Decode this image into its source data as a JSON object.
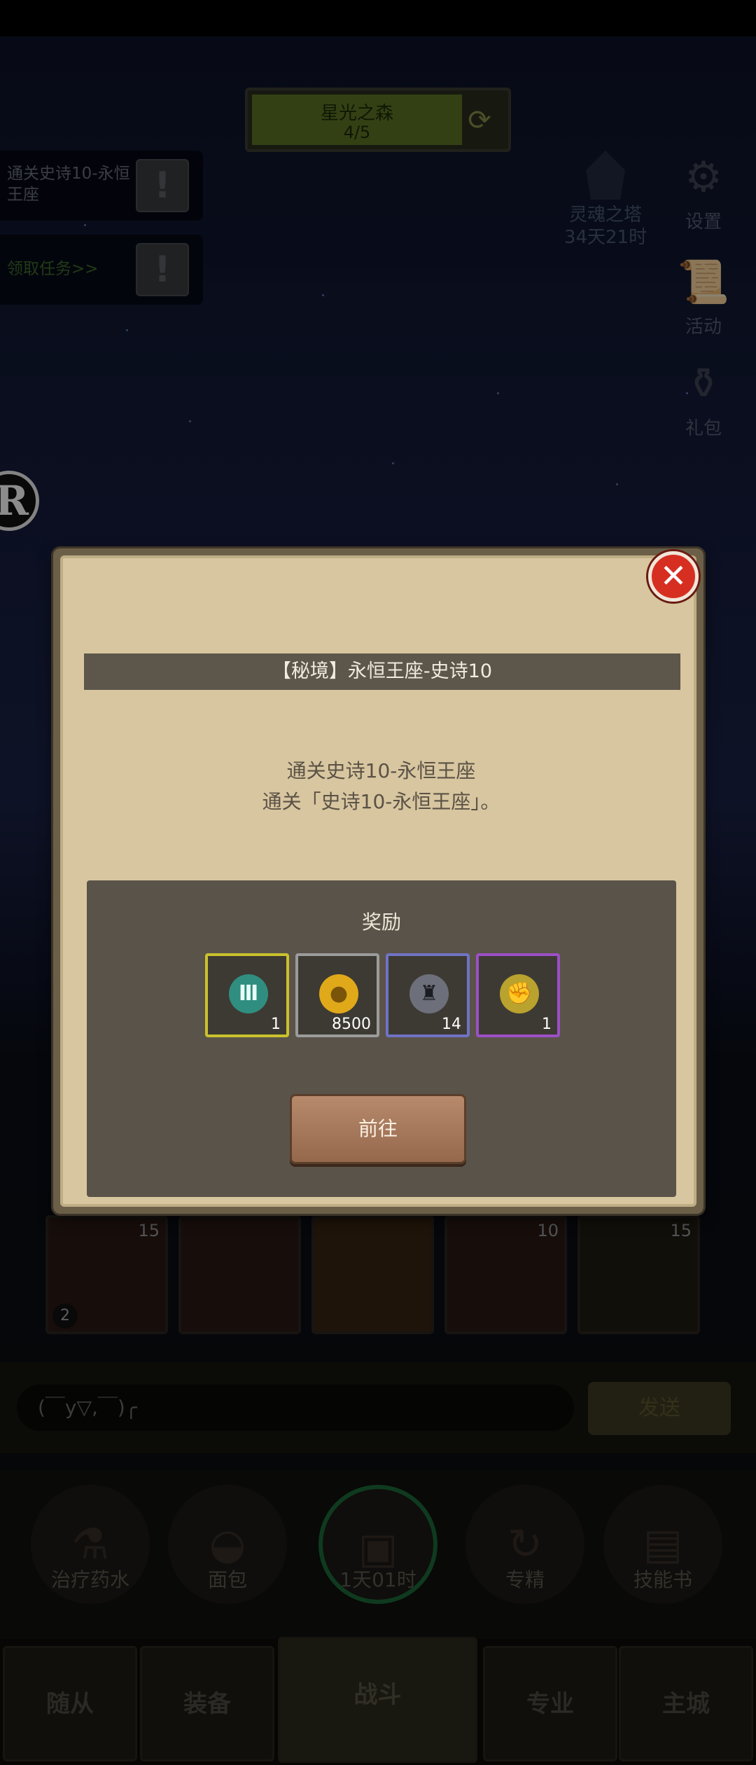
{
  "area": {
    "name": "星光之森",
    "progress": "4/5"
  },
  "quests": [
    {
      "text": "通关史诗10-永恒王座"
    },
    {
      "text": "领取任务>>"
    }
  ],
  "tower": {
    "name": "灵魂之塔",
    "timer": "34天21时"
  },
  "side_buttons": [
    {
      "label": "设置",
      "icon": "gear-icon"
    },
    {
      "label": "活动",
      "icon": "scroll-icon"
    },
    {
      "label": "礼包",
      "icon": "gift-pot-icon"
    }
  ],
  "heroes": [
    {
      "level": "15",
      "sub": "2"
    },
    {
      "level": "",
      "sub": ""
    },
    {
      "level": "",
      "sub": ""
    },
    {
      "level": "10",
      "sub": ""
    },
    {
      "level": "15",
      "sub": ""
    }
  ],
  "chat": {
    "placeholder": "(￣y▽,￣)╭",
    "send_label": "发送"
  },
  "shop": [
    {
      "label": "治疗药水",
      "icon": "potion-icon"
    },
    {
      "label": "面包",
      "icon": "bread-icon"
    },
    {
      "label": "1天01时",
      "icon": "chest-icon"
    },
    {
      "label": "专精",
      "icon": "specialization-icon"
    },
    {
      "label": "技能书",
      "icon": "skill-book-icon"
    }
  ],
  "nav": {
    "followers": "随从",
    "equipment": "装备",
    "battle": "战斗",
    "profession": "专业",
    "main_city": "主城"
  },
  "dialog": {
    "title": "【秘境】永恒王座-史诗10",
    "desc_line1": "通关史诗10-永恒王座",
    "desc_line2": "通关「史诗10-永恒王座」。",
    "reward_title": "奖励",
    "rewards": [
      {
        "icon": "rune-III-icon",
        "count": "1",
        "frame_color": "#c9c12c",
        "bg": "#2f8e80"
      },
      {
        "icon": "gold-coin-icon",
        "count": "8500",
        "frame_color": "#9b9b9b",
        "bg": "#e0a91a"
      },
      {
        "icon": "horned-helmet-icon",
        "count": "14",
        "frame_color": "#6f73c4",
        "bg": "#6d6f7a"
      },
      {
        "icon": "gauntlet-icon",
        "count": "1",
        "frame_color": "#9c4fc7",
        "bg": "#b9a22e"
      }
    ],
    "go_label": "前往",
    "close_icon": "close-icon"
  }
}
